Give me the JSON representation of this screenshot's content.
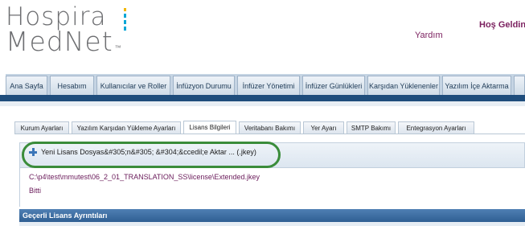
{
  "brand": {
    "line1": "Hospira",
    "line2": "MedNet",
    "tm": "™",
    "bar_colors": [
      "#f2b705",
      "#00a6d6",
      "#00a6d6",
      "#00a6d6"
    ]
  },
  "header": {
    "help": "Yardım",
    "welcome": "Hoş Geldiniz"
  },
  "nav": {
    "items": [
      {
        "label": "Ana Sayfa"
      },
      {
        "label": "Hesabım"
      },
      {
        "label": "Kullanıcılar ve Roller"
      },
      {
        "label": "İnfüzyon Durumu"
      },
      {
        "label": "İnfüzer Yönetimi"
      },
      {
        "label": "İnfüzer Günlükleri"
      },
      {
        "label": "Karşıdan Yüklenenler"
      },
      {
        "label": "Yazılım İçe Aktarma"
      }
    ]
  },
  "subtabs": [
    {
      "label": "Kurum Ayarları"
    },
    {
      "label": "Yazılım Karşıdan Yükleme Ayarları"
    },
    {
      "label": "Lisans Bilgileri"
    },
    {
      "label": "Veritabanı Bakımı"
    },
    {
      "label": "Yer Ayarı"
    },
    {
      "label": "SMTP Bakımı"
    },
    {
      "label": "Entegrasyon Ayarları"
    }
  ],
  "import": {
    "label": "Yeni Lisans Dosyas&#305;n&#305; &#304;&ccedil;e Aktar ... (.jkey)",
    "icon": "plus-icon"
  },
  "result": {
    "path": "C:\\p4\\test\\mmutest\\06_2_01_TRANSLATION_SS\\license\\Extended.jkey",
    "status": "Bitti"
  },
  "section": {
    "title": "Geçerli Lisans Ayrıntıları"
  },
  "colors": {
    "accent": "#1f4d7c",
    "link": "#6a1b5a",
    "highlight": "#3a8c3a"
  }
}
